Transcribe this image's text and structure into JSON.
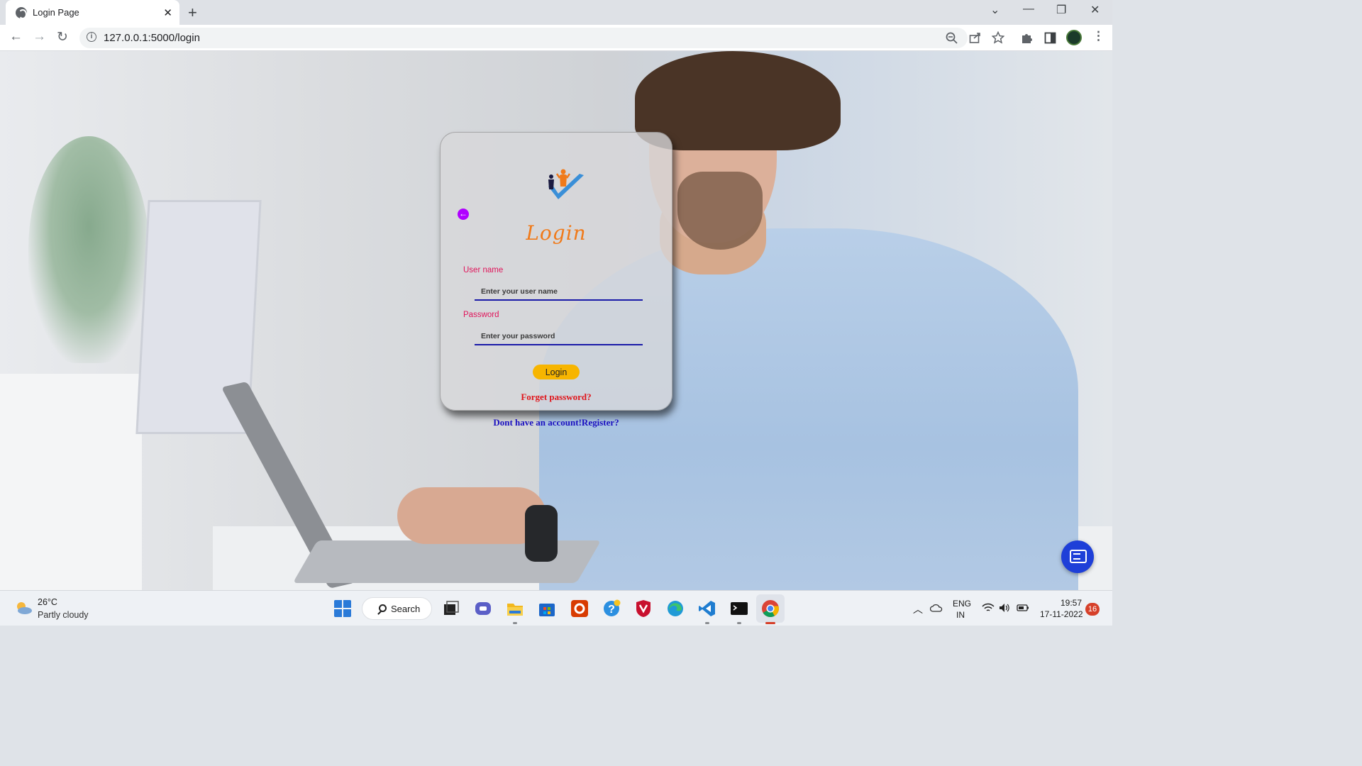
{
  "browser": {
    "tab_title": "Login Page",
    "tab_close": "✕",
    "new_tab": "+",
    "url": "127.0.0.1:5000/login",
    "window_controls": {
      "dropdown": "⌄",
      "minimize": "—",
      "restore": "❐",
      "close": "✕"
    },
    "nav": {
      "back": "←",
      "forward": "→",
      "reload": "↻"
    },
    "toolbar_icons": [
      "zoom-icon",
      "share-icon",
      "bookmark-star-icon",
      "extensions-icon",
      "side-panel-icon",
      "profile-avatar",
      "menu-icon"
    ]
  },
  "login": {
    "title": "Login",
    "back_icon": "←",
    "username_label": "User name",
    "username_placeholder": "Enter your user name",
    "password_label": "Password",
    "password_placeholder": "Enter your password",
    "login_button": "Login",
    "forget_link": "Forget password?",
    "register_link": "Dont have an account!Register?"
  },
  "colors": {
    "title": "#f07a1a",
    "labels": "#e0145a",
    "field_underline": "#1a1aa8",
    "login_button": "#f7b500",
    "forget_link": "#e0141a",
    "register_link": "#1a10c0",
    "back_button": "#b000ff",
    "chat_button": "#1e3fd8"
  },
  "taskbar": {
    "weather_temp": "26°C",
    "weather_desc": "Partly cloudy",
    "search_label": "Search",
    "apps": [
      "windows-start-icon",
      "task-view-icon",
      "teams-chat-icon",
      "file-explorer-icon",
      "microsoft-store-icon",
      "office-icon",
      "help-icon",
      "mcafee-icon",
      "edge-icon",
      "vscode-icon",
      "terminal-icon",
      "chrome-icon"
    ],
    "language": "ENG",
    "region": "IN",
    "time": "19:57",
    "date": "17-11-2022",
    "notifications": "16"
  }
}
